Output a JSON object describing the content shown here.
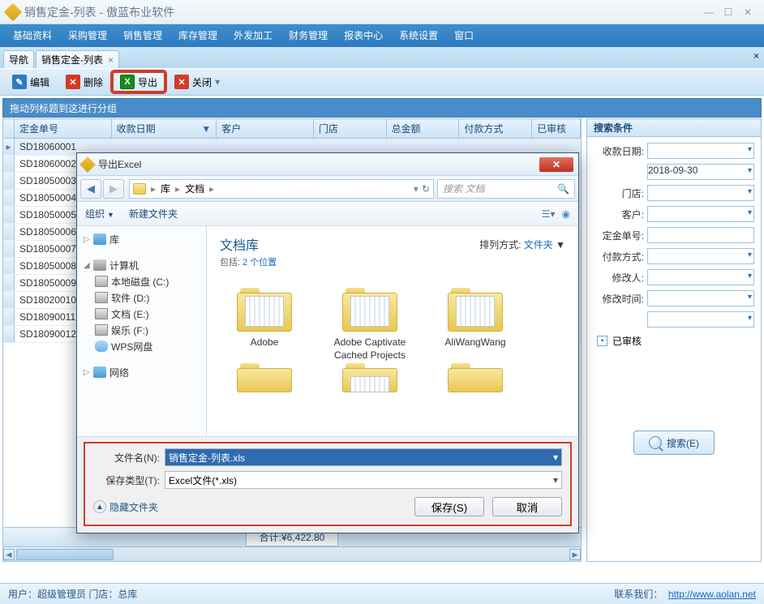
{
  "window": {
    "title": "销售定金-列表 - 傲蓝布业软件"
  },
  "menu": [
    "基础资料",
    "采购管理",
    "销售管理",
    "库存管理",
    "外发加工",
    "财务管理",
    "报表中心",
    "系统设置",
    "窗口"
  ],
  "tabs": [
    {
      "label": "导航",
      "closable": false
    },
    {
      "label": "销售定金-列表",
      "closable": true
    }
  ],
  "toolbar": {
    "edit": "编辑",
    "delete": "删除",
    "export": "导出",
    "close": "关闭"
  },
  "group_hint": "拖动列标题到这进行分组",
  "columns": [
    "定金单号",
    "收款日期",
    "客户",
    "门店",
    "总金额",
    "付款方式",
    "已审核"
  ],
  "sort_col": 1,
  "rows": [
    "SD18060001",
    "SD18060002",
    "SD18050003",
    "SD18050004",
    "SD18050005",
    "SD18050006",
    "SD18050007",
    "SD18050008",
    "SD18050009",
    "SD18020010",
    "SD18090011",
    "SD18090012"
  ],
  "footer_total": "合计:¥6,422.80",
  "search": {
    "title": "搜索条件",
    "fields": {
      "date_label": "收款日期:",
      "date_to": "2018-09-30",
      "store": "门店:",
      "customer": "客户:",
      "order_no": "定金单号:",
      "pay_method": "付款方式:",
      "modifier": "修改人:",
      "modify_time": "修改时间:",
      "approved": "已审核"
    },
    "button": "搜索(E)"
  },
  "status": {
    "left": "用户：超级管理员  门店：总库",
    "contact": "联系我们：",
    "link": "http://www.aolan.net"
  },
  "dialog": {
    "title": "导出Excel",
    "crumb_lib": "库",
    "crumb_doc": "文档",
    "search_placeholder": "搜索 文档",
    "organize": "组织",
    "newfolder": "新建文件夹",
    "tree": {
      "lib": "库",
      "computer": "计算机",
      "d_c": "本地磁盘 (C:)",
      "d_d": "软件 (D:)",
      "d_e": "文档 (E:)",
      "d_f": "娱乐 (F:)",
      "wps": "WPS网盘",
      "network": "网络"
    },
    "files_header": "文档库",
    "files_sub_prefix": "包括: ",
    "files_sub_link": "2 个位置",
    "sort_label": "排列方式:",
    "sort_value": "文件夹",
    "folders": [
      "Adobe",
      "Adobe Captivate Cached Projects",
      "AliWangWang"
    ],
    "filename_label": "文件名(N):",
    "filename_value": "销售定金-列表.xls",
    "filetype_label": "保存类型(T):",
    "filetype_value": "Excel文件(*.xls)",
    "hide_folders": "隐藏文件夹",
    "save": "保存(S)",
    "cancel": "取消"
  }
}
